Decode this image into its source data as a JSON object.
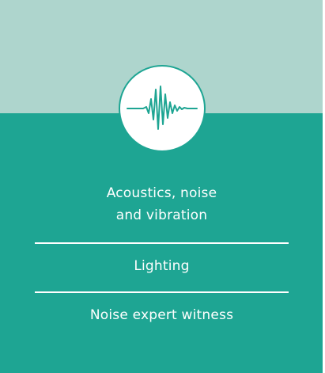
{
  "card": {
    "colors": {
      "header": "#aed5cd",
      "body": "#1ea593",
      "text": "#ffffff"
    },
    "emblem_icon": "sound-wave-icon",
    "items": [
      {
        "label": "Acoustics, noise\nand vibration"
      },
      {
        "label": "Lighting"
      },
      {
        "label": "Noise expert witness"
      }
    ]
  }
}
